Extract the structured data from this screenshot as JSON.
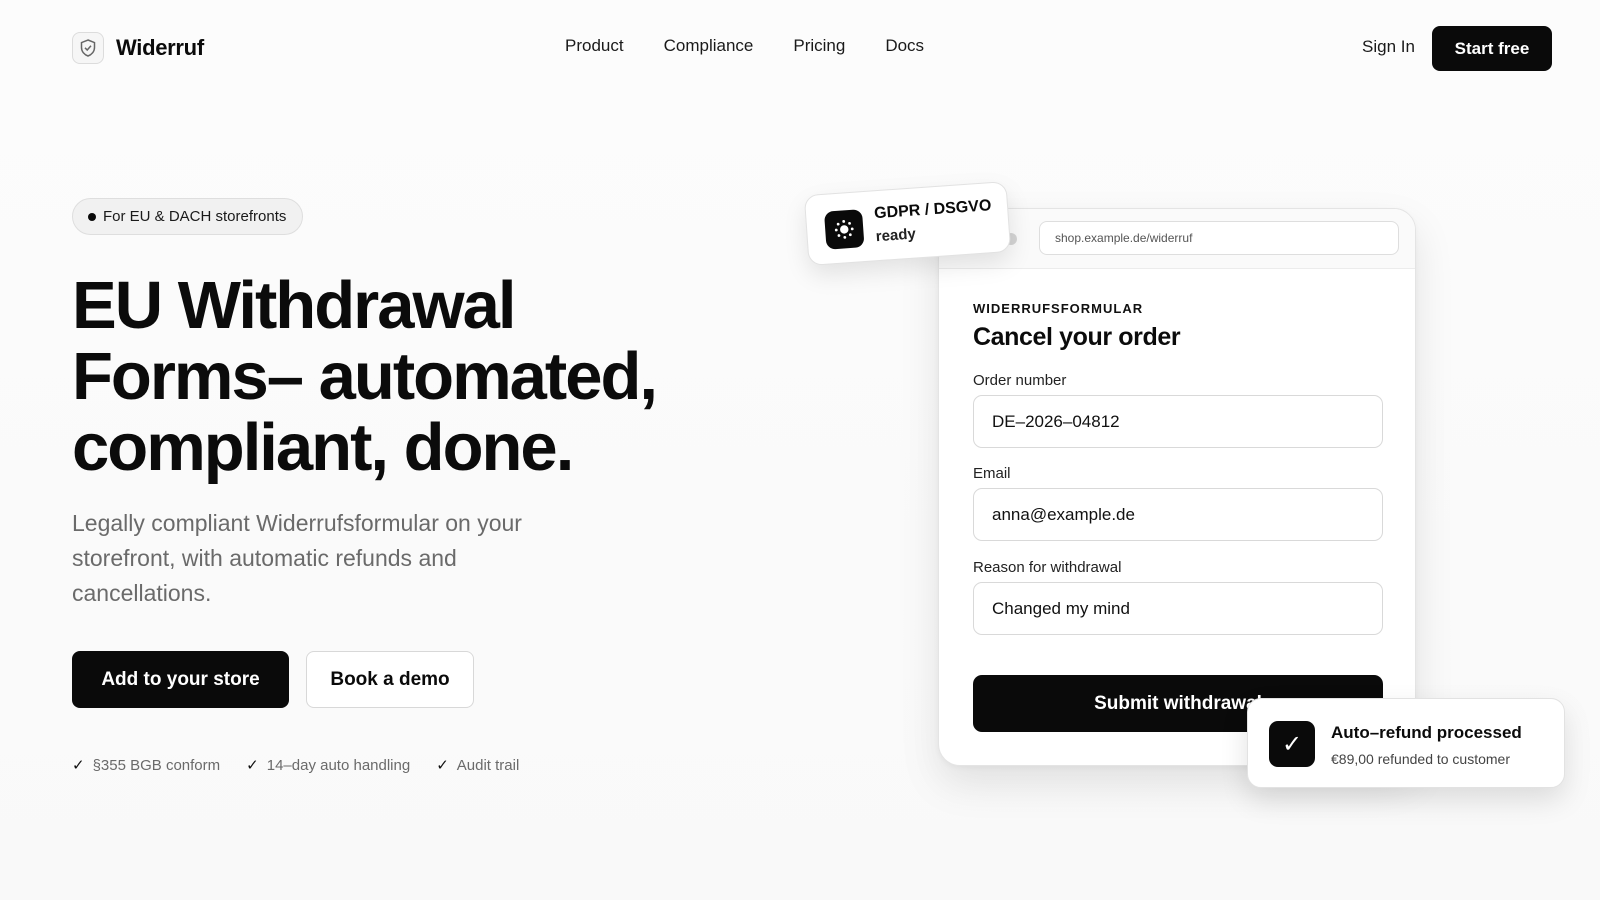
{
  "brand": {
    "name": "Widerruf",
    "logo_icon": "shield-icon"
  },
  "nav": {
    "links": [
      "Product",
      "Compliance",
      "Pricing",
      "Docs"
    ],
    "sign_in": "Sign In",
    "start_free": "Start free"
  },
  "hero": {
    "pill": "For EU & DACH storefronts",
    "headline": "EU Withdrawal Forms– automated, compliant, done.",
    "subtext": "Legally compliant Widerrufsformular on your storefront, with automatic refunds and cancellations.",
    "primary_cta": "Add to your store",
    "secondary_cta": "Book a demo",
    "checks": [
      "§355 BGB conform",
      "14–day auto handling",
      "Audit trail"
    ]
  },
  "form_card": {
    "url": "shop.example.de/widerruf",
    "eyebrow": "WIDERRUFSFORMULAR",
    "title": "Cancel your order",
    "fields": [
      {
        "label": "Order number",
        "value": "DE–2026–04812"
      },
      {
        "label": "Email",
        "value": "anna@example.de"
      },
      {
        "label": "Reason for withdrawal",
        "value": "Changed my mind"
      }
    ],
    "submit": "Submit withdrawal"
  },
  "gdpr_badge": {
    "line1": "GDPR / DSGVO",
    "line2": "ready",
    "icon": "eu-stars-icon"
  },
  "toast": {
    "title": "Auto–refund processed",
    "subtitle": "€89,00 refunded to customer",
    "icon": "check-icon"
  },
  "colors": {
    "primary": "#0a0a0a",
    "background": "#fbfbfb",
    "muted_text": "#6a6a6a"
  }
}
